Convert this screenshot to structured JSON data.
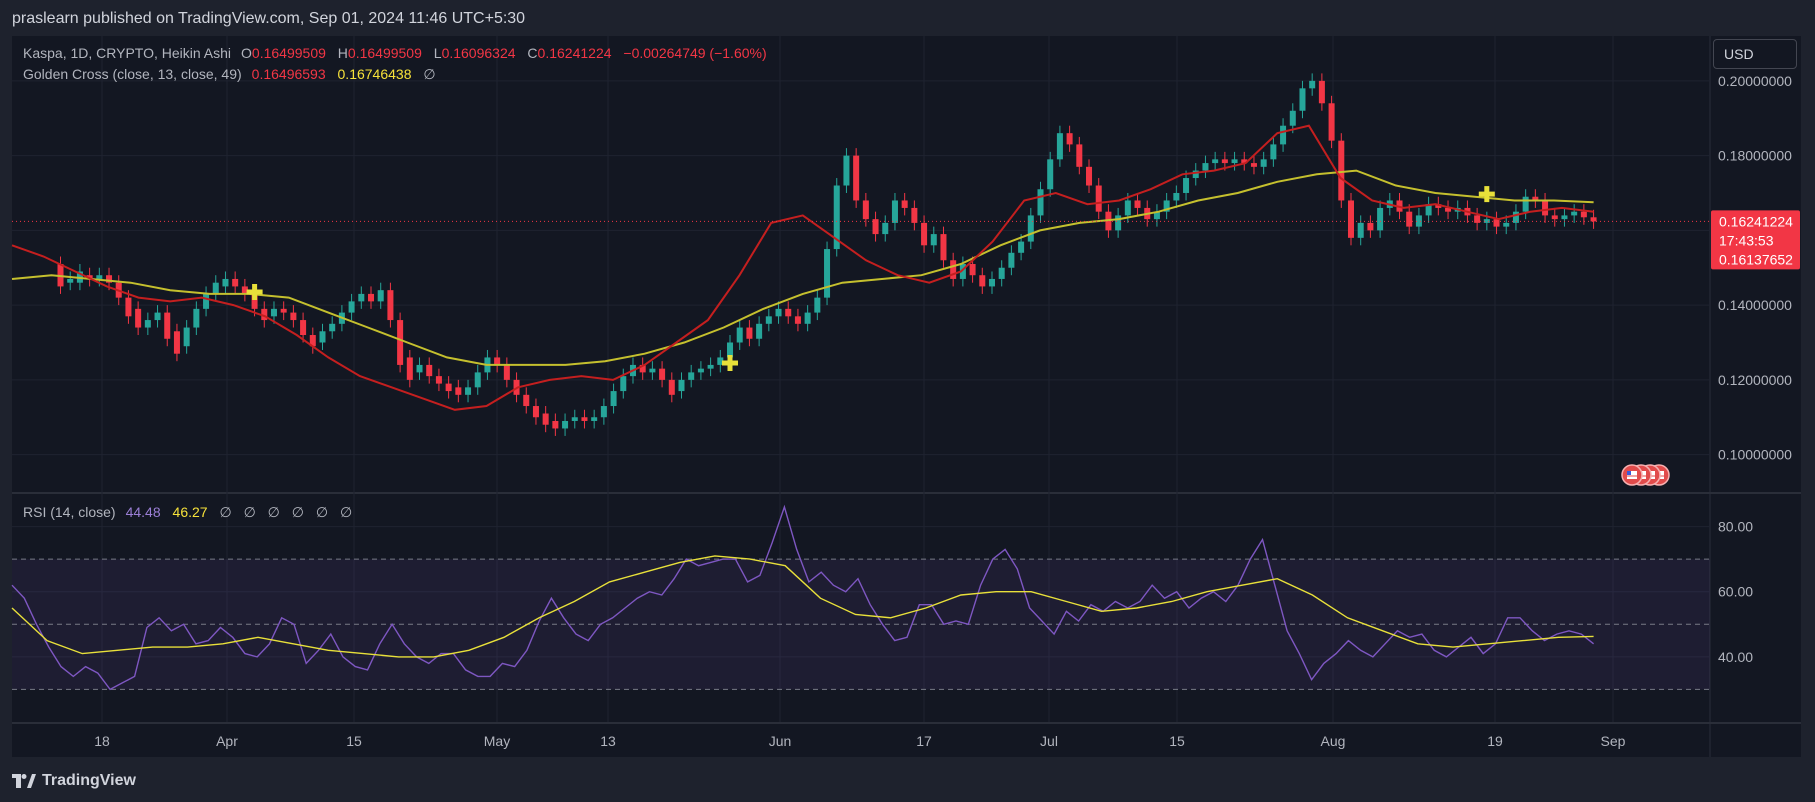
{
  "header": {
    "published_text": "praslearn published on TradingView.com, Sep 01, 2024 11:46 UTC+5:30"
  },
  "footer": {
    "brand": "TradingView"
  },
  "legend": {
    "symbol": "Kaspa, 1D, CRYPTO, Heikin Ashi",
    "o_label": "O",
    "o_value": "0.16499509",
    "h_label": "H",
    "h_value": "0.16499509",
    "l_label": "L",
    "l_value": "0.16096324",
    "c_label": "C",
    "c_value": "0.16241224",
    "change": "−0.00264749 (−1.60%)",
    "indicator_name": "Golden Cross (close, 13, close, 49)",
    "fast_value": "0.16496593",
    "slow_value": "0.16746438",
    "indicator_extra": "∅"
  },
  "rsi_legend": {
    "name": "RSI (14, close)",
    "rsi_value": "44.48",
    "ma_value": "46.27",
    "empties": [
      "∅",
      "∅",
      "∅",
      "∅",
      "∅",
      "∅"
    ]
  },
  "currency_button": "USD",
  "price_labels": {
    "last_price": "0.16241224",
    "countdown": "17:43:53",
    "second_price": "0.16137652"
  },
  "colors": {
    "background": "#131722",
    "up": "#26a69a",
    "down": "#f23645",
    "fast_ma": "#c41f1f",
    "slow_ma": "#c5c02e",
    "rsi": "#7e57c2",
    "rsi_ma": "#e8e03a",
    "cross_marker": "#e8e03a",
    "text": "#b2b5be"
  },
  "events_icon": "us-flag-events-icon",
  "chart_data": [
    {
      "type": "candlestick",
      "style": "Heikin Ashi",
      "x_ticks": [
        "18",
        "Apr",
        "15",
        "May",
        "13",
        "Jun",
        "17",
        "Jul",
        "15",
        "Aug",
        "19",
        "Sep"
      ],
      "y_ticks": [
        "0.10000000",
        "0.12000000",
        "0.14000000",
        "0.16000000",
        "0.18000000",
        "0.20000000"
      ],
      "y_range": [
        0.09,
        0.212
      ],
      "x_range": [
        -5,
        170
      ],
      "candles": [
        [
          0,
          0.151,
          0.145
        ],
        [
          1,
          0.146,
          0.147
        ],
        [
          2,
          0.146,
          0.149
        ],
        [
          3,
          0.148,
          0.147
        ],
        [
          4,
          0.147,
          0.148
        ],
        [
          5,
          0.148,
          0.146
        ],
        [
          6,
          0.146,
          0.142
        ],
        [
          7,
          0.142,
          0.137
        ],
        [
          8,
          0.139,
          0.134
        ],
        [
          9,
          0.134,
          0.136
        ],
        [
          10,
          0.136,
          0.138
        ],
        [
          11,
          0.138,
          0.131
        ],
        [
          12,
          0.133,
          0.127
        ],
        [
          13,
          0.129,
          0.134
        ],
        [
          14,
          0.134,
          0.139
        ],
        [
          15,
          0.139,
          0.143
        ],
        [
          16,
          0.143,
          0.146
        ],
        [
          17,
          0.145,
          0.147
        ],
        [
          18,
          0.147,
          0.145
        ],
        [
          19,
          0.145,
          0.143
        ],
        [
          20,
          0.143,
          0.139
        ],
        [
          21,
          0.139,
          0.136
        ],
        [
          22,
          0.137,
          0.139
        ],
        [
          23,
          0.139,
          0.138
        ],
        [
          24,
          0.138,
          0.136
        ],
        [
          25,
          0.136,
          0.132
        ],
        [
          26,
          0.132,
          0.129
        ],
        [
          27,
          0.13,
          0.133
        ],
        [
          28,
          0.133,
          0.135
        ],
        [
          29,
          0.135,
          0.138
        ],
        [
          30,
          0.138,
          0.141
        ],
        [
          31,
          0.141,
          0.143
        ],
        [
          32,
          0.143,
          0.141
        ],
        [
          33,
          0.141,
          0.144
        ],
        [
          34,
          0.144,
          0.136
        ],
        [
          35,
          0.136,
          0.124
        ],
        [
          36,
          0.126,
          0.12
        ],
        [
          37,
          0.122,
          0.124
        ],
        [
          38,
          0.124,
          0.121
        ],
        [
          39,
          0.121,
          0.119
        ],
        [
          40,
          0.119,
          0.117
        ],
        [
          41,
          0.118,
          0.116
        ],
        [
          42,
          0.116,
          0.118
        ],
        [
          43,
          0.118,
          0.122
        ],
        [
          44,
          0.122,
          0.126
        ],
        [
          45,
          0.126,
          0.124
        ],
        [
          46,
          0.124,
          0.12
        ],
        [
          47,
          0.12,
          0.116
        ],
        [
          48,
          0.116,
          0.113
        ],
        [
          49,
          0.113,
          0.11
        ],
        [
          50,
          0.111,
          0.108
        ],
        [
          51,
          0.109,
          0.107
        ],
        [
          52,
          0.107,
          0.109
        ],
        [
          53,
          0.109,
          0.11
        ],
        [
          54,
          0.11,
          0.109
        ],
        [
          55,
          0.109,
          0.11
        ],
        [
          56,
          0.11,
          0.113
        ],
        [
          57,
          0.113,
          0.117
        ],
        [
          58,
          0.117,
          0.121
        ],
        [
          59,
          0.121,
          0.124
        ],
        [
          60,
          0.124,
          0.122
        ],
        [
          61,
          0.122,
          0.123
        ],
        [
          62,
          0.123,
          0.12
        ],
        [
          63,
          0.12,
          0.116
        ],
        [
          64,
          0.117,
          0.12
        ],
        [
          65,
          0.12,
          0.122
        ],
        [
          66,
          0.122,
          0.123
        ],
        [
          67,
          0.123,
          0.124
        ],
        [
          68,
          0.124,
          0.126
        ],
        [
          69,
          0.126,
          0.13
        ],
        [
          70,
          0.13,
          0.134
        ],
        [
          71,
          0.134,
          0.131
        ],
        [
          72,
          0.131,
          0.135
        ],
        [
          73,
          0.135,
          0.137
        ],
        [
          74,
          0.137,
          0.139
        ],
        [
          75,
          0.139,
          0.137
        ],
        [
          76,
          0.137,
          0.135
        ],
        [
          77,
          0.135,
          0.138
        ],
        [
          78,
          0.138,
          0.142
        ],
        [
          79,
          0.142,
          0.155
        ],
        [
          80,
          0.155,
          0.172
        ],
        [
          81,
          0.172,
          0.18
        ],
        [
          82,
          0.18,
          0.168
        ],
        [
          83,
          0.168,
          0.163
        ],
        [
          84,
          0.163,
          0.159
        ],
        [
          85,
          0.159,
          0.162
        ],
        [
          86,
          0.162,
          0.168
        ],
        [
          87,
          0.168,
          0.166
        ],
        [
          88,
          0.166,
          0.162
        ],
        [
          89,
          0.162,
          0.156
        ],
        [
          90,
          0.156,
          0.159
        ],
        [
          91,
          0.159,
          0.152
        ],
        [
          92,
          0.152,
          0.147
        ],
        [
          93,
          0.147,
          0.151
        ],
        [
          94,
          0.151,
          0.148
        ],
        [
          95,
          0.148,
          0.145
        ],
        [
          96,
          0.145,
          0.147
        ],
        [
          97,
          0.147,
          0.15
        ],
        [
          98,
          0.15,
          0.154
        ],
        [
          99,
          0.154,
          0.157
        ],
        [
          100,
          0.157,
          0.164
        ],
        [
          101,
          0.164,
          0.171
        ],
        [
          102,
          0.171,
          0.179
        ],
        [
          103,
          0.179,
          0.186
        ],
        [
          104,
          0.186,
          0.183
        ],
        [
          105,
          0.183,
          0.177
        ],
        [
          106,
          0.177,
          0.172
        ],
        [
          107,
          0.172,
          0.165
        ],
        [
          108,
          0.165,
          0.16
        ],
        [
          109,
          0.16,
          0.164
        ],
        [
          110,
          0.164,
          0.168
        ],
        [
          111,
          0.168,
          0.166
        ],
        [
          112,
          0.166,
          0.163
        ],
        [
          113,
          0.163,
          0.165
        ],
        [
          114,
          0.165,
          0.168
        ],
        [
          115,
          0.168,
          0.17
        ],
        [
          116,
          0.17,
          0.174
        ],
        [
          117,
          0.174,
          0.176
        ],
        [
          118,
          0.176,
          0.178
        ],
        [
          119,
          0.178,
          0.179
        ],
        [
          120,
          0.179,
          0.178
        ],
        [
          121,
          0.178,
          0.179
        ],
        [
          122,
          0.179,
          0.178
        ],
        [
          123,
          0.178,
          0.177
        ],
        [
          124,
          0.177,
          0.179
        ],
        [
          125,
          0.179,
          0.183
        ],
        [
          126,
          0.183,
          0.188
        ],
        [
          127,
          0.188,
          0.192
        ],
        [
          128,
          0.192,
          0.198
        ],
        [
          129,
          0.198,
          0.2
        ],
        [
          130,
          0.2,
          0.194
        ],
        [
          131,
          0.194,
          0.184
        ],
        [
          132,
          0.184,
          0.168
        ],
        [
          133,
          0.168,
          0.158
        ],
        [
          134,
          0.158,
          0.162
        ],
        [
          135,
          0.162,
          0.16
        ],
        [
          136,
          0.16,
          0.166
        ],
        [
          137,
          0.166,
          0.168
        ],
        [
          138,
          0.168,
          0.165
        ],
        [
          139,
          0.165,
          0.161
        ],
        [
          140,
          0.161,
          0.164
        ],
        [
          141,
          0.164,
          0.167
        ],
        [
          142,
          0.167,
          0.166
        ],
        [
          143,
          0.166,
          0.165
        ],
        [
          144,
          0.165,
          0.166
        ],
        [
          145,
          0.166,
          0.164
        ],
        [
          146,
          0.164,
          0.162
        ],
        [
          147,
          0.162,
          0.163
        ],
        [
          148,
          0.163,
          0.161
        ],
        [
          149,
          0.161,
          0.162
        ],
        [
          150,
          0.162,
          0.165
        ],
        [
          151,
          0.165,
          0.169
        ],
        [
          152,
          0.169,
          0.168
        ],
        [
          153,
          0.168,
          0.164
        ],
        [
          154,
          0.164,
          0.163
        ],
        [
          155,
          0.163,
          0.164
        ],
        [
          156,
          0.164,
          0.165
        ],
        [
          157,
          0.165,
          0.1635
        ],
        [
          158,
          0.1635,
          0.1624
        ]
      ],
      "fast_ma_values": [
        0.156,
        0.153,
        0.149,
        0.145,
        0.142,
        0.141,
        0.142,
        0.14,
        0.137,
        0.132,
        0.126,
        0.121,
        0.118,
        0.115,
        0.112,
        0.113,
        0.118,
        0.12,
        0.121,
        0.12,
        0.124,
        0.13,
        0.136,
        0.148,
        0.162,
        0.164,
        0.158,
        0.152,
        0.148,
        0.146,
        0.149,
        0.157,
        0.168,
        0.17,
        0.167,
        0.168,
        0.171,
        0.175,
        0.176,
        0.178,
        0.186,
        0.188,
        0.174,
        0.168,
        0.166,
        0.167,
        0.165,
        0.163,
        0.165,
        0.166,
        0.165
      ],
      "slow_ma_values": [
        0.147,
        0.148,
        0.147,
        0.146,
        0.144,
        0.143,
        0.143,
        0.142,
        0.138,
        0.134,
        0.13,
        0.126,
        0.124,
        0.124,
        0.124,
        0.125,
        0.127,
        0.13,
        0.134,
        0.139,
        0.143,
        0.146,
        0.147,
        0.148,
        0.151,
        0.156,
        0.16,
        0.162,
        0.163,
        0.165,
        0.168,
        0.17,
        0.173,
        0.175,
        0.176,
        0.172,
        0.17,
        0.169,
        0.168,
        0.168,
        0.1675
      ],
      "golden_cross_markers": [
        {
          "x": 20,
          "y": 0.1435
        },
        {
          "x": 69,
          "y": 0.1245
        },
        {
          "x": 147,
          "y": 0.1697
        }
      ],
      "last_price": 0.16241224
    },
    {
      "type": "line",
      "title": "RSI (14, close)",
      "y_ticks": [
        "40.00",
        "60.00",
        "80.00"
      ],
      "y_range": [
        20,
        90
      ],
      "bands": [
        30,
        50,
        70
      ],
      "rsi_values": [
        62,
        58,
        50,
        43,
        37,
        34,
        37,
        35,
        30,
        32,
        34,
        49,
        52,
        48,
        50,
        44,
        45,
        49,
        46,
        41,
        40,
        44,
        52,
        50,
        38,
        42,
        47,
        40,
        37,
        36,
        44,
        50,
        44,
        40,
        38,
        41,
        41,
        36,
        34,
        34,
        38,
        37,
        42,
        51,
        58,
        52,
        47,
        45,
        50,
        52,
        55,
        58,
        60,
        59,
        64,
        70,
        68,
        69,
        70,
        70,
        63,
        65,
        75,
        86,
        73,
        63,
        66,
        62,
        60,
        64,
        56,
        50,
        45,
        46,
        56,
        56,
        50,
        51,
        50,
        62,
        70,
        73,
        67,
        55,
        51,
        47,
        54,
        51,
        56,
        54,
        57,
        55,
        57,
        62,
        58,
        60,
        55,
        58,
        60,
        57,
        62,
        70,
        76,
        62,
        48,
        41,
        33,
        38,
        41,
        45,
        42,
        40,
        44,
        48,
        46,
        47,
        42,
        40,
        43,
        46,
        41,
        44,
        52,
        52,
        48,
        45,
        47,
        48,
        47,
        44
      ],
      "rsi_ma_values": [
        55,
        45,
        41,
        42,
        43,
        43,
        44,
        46,
        44,
        42,
        41,
        40,
        40,
        42,
        46,
        52,
        57,
        63,
        66,
        69,
        71,
        70,
        68,
        58,
        53,
        52,
        55,
        59,
        60,
        60,
        57,
        54,
        55,
        57,
        60,
        62,
        64,
        59,
        52,
        48,
        44,
        43,
        44,
        45,
        46,
        46.27
      ]
    }
  ]
}
